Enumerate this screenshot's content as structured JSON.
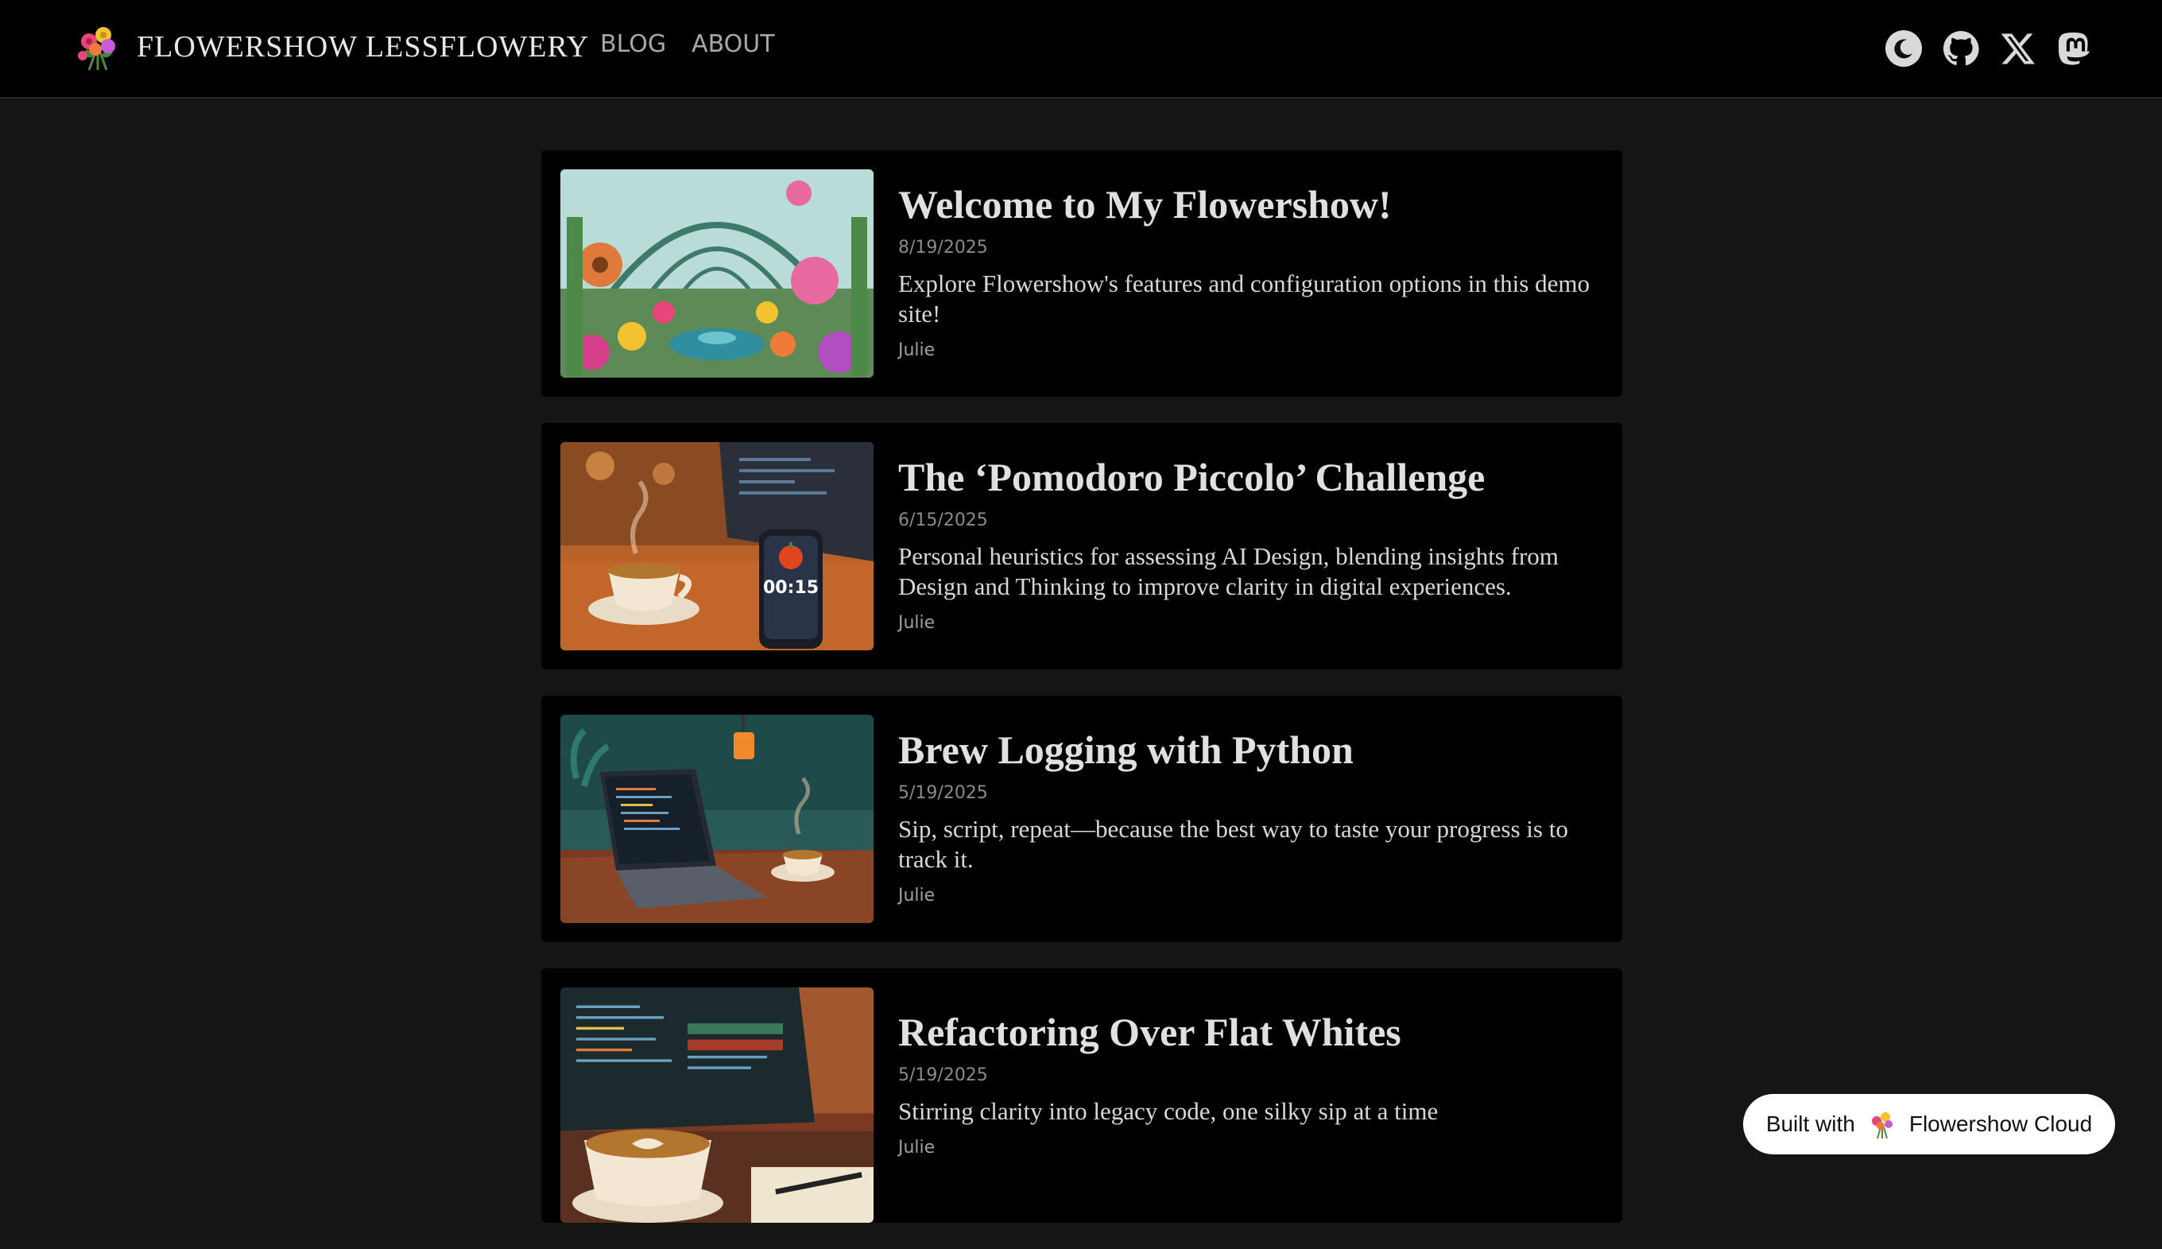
{
  "site": {
    "name": "FLOWERSHOW LESSFLOWERY"
  },
  "nav": [
    {
      "label": "BLOG"
    },
    {
      "label": "ABOUT"
    }
  ],
  "header_icons": [
    "moon-icon",
    "github-icon",
    "x-icon",
    "mastodon-icon"
  ],
  "posts": [
    {
      "title": "Welcome to My Flowershow!",
      "date": "8/19/2025",
      "description": "Explore Flowershow's features and configuration options in this demo site!",
      "author": "Julie",
      "image": "greenhouse-garden-illustration"
    },
    {
      "title": "The ‘Pomodoro Piccolo’ Challenge",
      "date": "6/15/2025",
      "description": "Personal heuristics for assessing AI Design, blending insights from Design and Thinking to improve clarity in digital experiences.",
      "author": "Julie",
      "image": "coffee-and-phone-timer-illustration",
      "timer_text": "00:15"
    },
    {
      "title": "Brew Logging with Python",
      "date": "5/19/2025",
      "description": "Sip, script, repeat—because the best way to taste your progress is to track it.",
      "author": "Julie",
      "image": "laptop-and-coffee-illustration"
    },
    {
      "title": "Refactoring Over Flat Whites",
      "date": "5/19/2025",
      "description": "Stirring clarity into legacy code, one silky sip at a time",
      "author": "Julie",
      "image": "code-screen-and-latte-illustration"
    }
  ],
  "badge": {
    "prefix": "Built with",
    "product": "Flowershow Cloud"
  },
  "colors": {
    "page_bg": "#151515",
    "card_bg": "#000000",
    "accent_text": "#e0e0e0"
  }
}
